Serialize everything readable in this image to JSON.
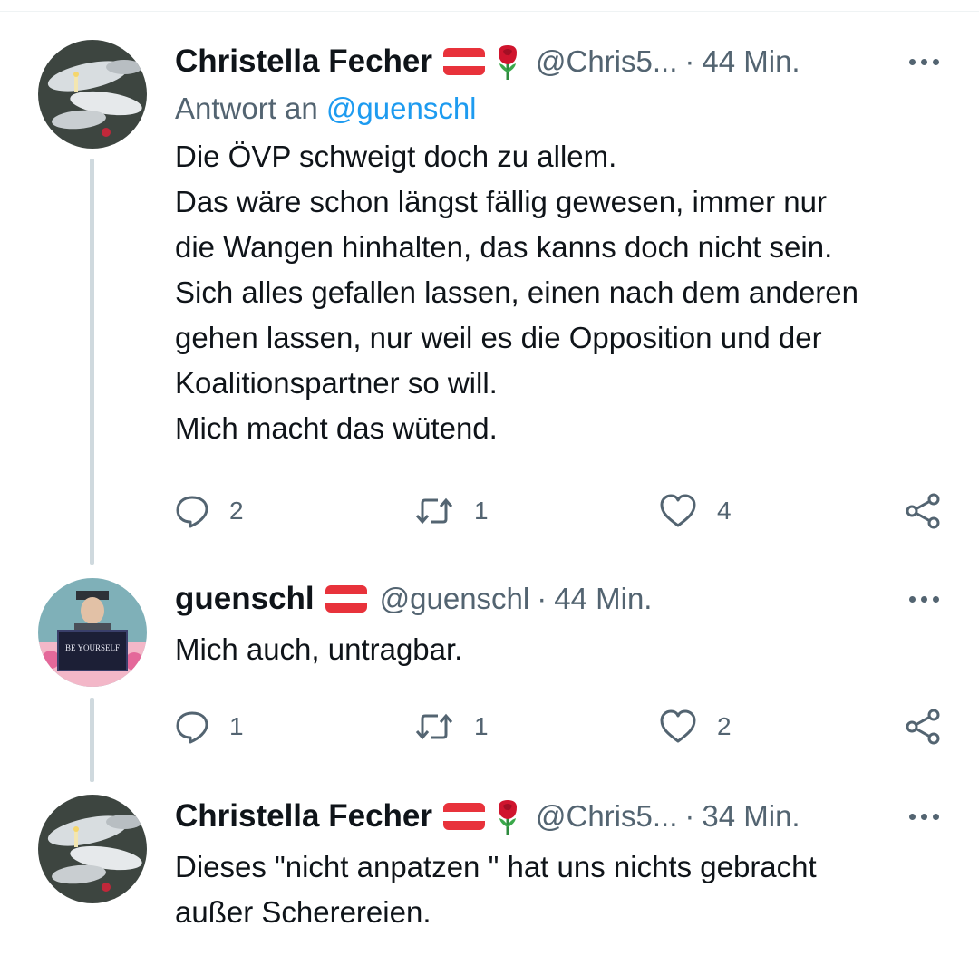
{
  "tweets": [
    {
      "name": "Christella Fecher",
      "handle": "@Chris5...",
      "sep": "·",
      "time": "44 Min.",
      "reply_prefix": "Antwort an",
      "reply_mention": "@guenschl",
      "text": "Die ÖVP schweigt doch zu allem.\nDas wäre schon längst fällig gewesen, immer nur\ndie Wangen hinhalten, das kanns doch nicht sein.\nSich alles gefallen lassen, einen nach dem anderen\ngehen lassen, nur weil es die Opposition und der\nKoalitionspartner so will.\nMich macht das wütend.",
      "replies": "2",
      "retweets": "1",
      "likes": "4"
    },
    {
      "name": "guenschl",
      "handle": "@guenschl",
      "sep": "·",
      "time": "44 Min.",
      "text": "Mich auch, untragbar.",
      "replies": "1",
      "retweets": "1",
      "likes": "2",
      "avatar_text": "BE YOURSELF"
    },
    {
      "name": "Christella Fecher",
      "handle": "@Chris5...",
      "sep": "·",
      "time": "34 Min.",
      "text": "Dieses \"nicht anpatzen \" hat uns nichts gebracht\naußer Scherereien."
    }
  ],
  "icons": {
    "reply": "speech-bubble-icon",
    "retweet": "retweet-arrows-icon",
    "like": "heart-icon",
    "share": "share-nodes-icon",
    "more": "more-dots-icon",
    "flag": "austria-flag-icon",
    "rose": "red-rose-icon"
  },
  "colors": {
    "text": "#0f1419",
    "secondary": "#536471",
    "link": "#1d9bf0",
    "thread_line": "#cfd9de",
    "flag_red": "#e8323b"
  }
}
